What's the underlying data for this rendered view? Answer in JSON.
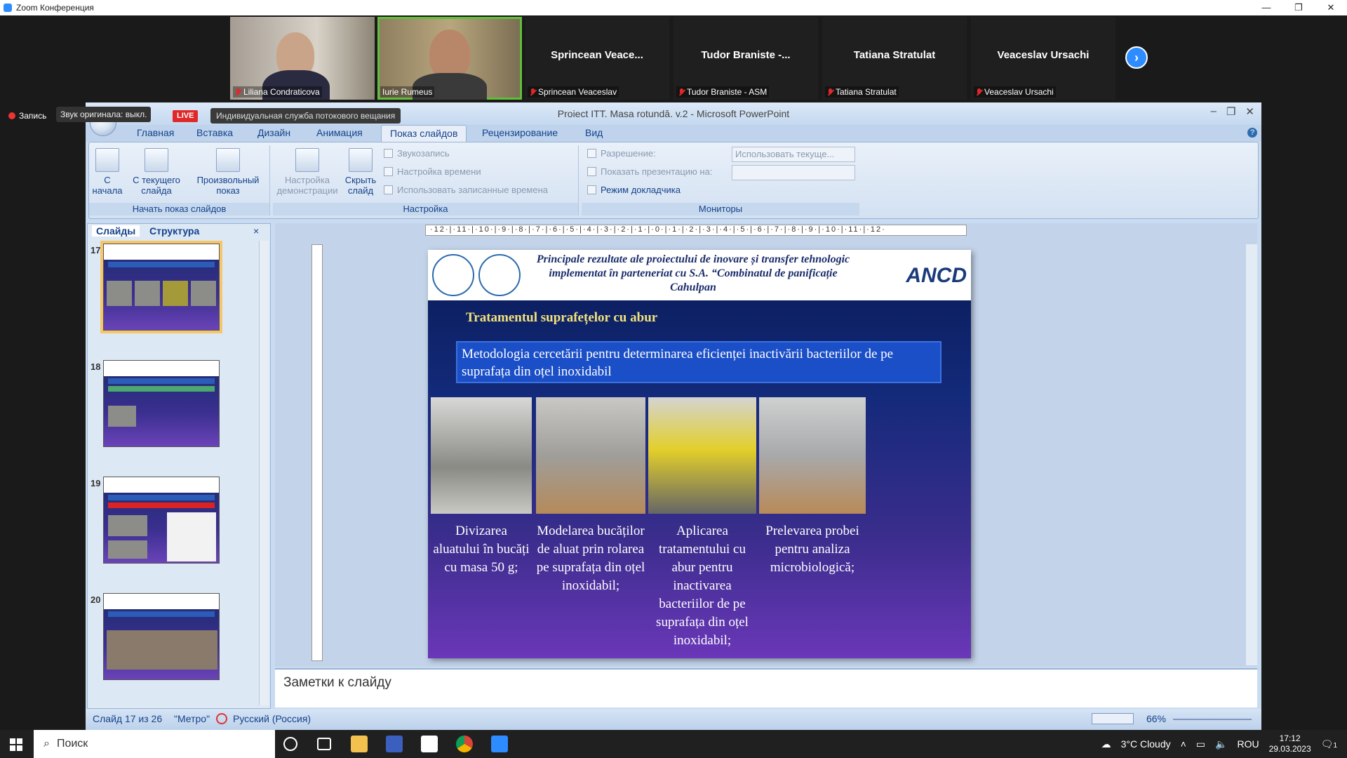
{
  "zoom": {
    "title": "Zoom Конференция"
  },
  "gallery": [
    {
      "label": "Liliana Condraticova",
      "name": ""
    },
    {
      "label": "Iurie Rumeus",
      "name": ""
    },
    {
      "label": "Sprincean Veaceslav",
      "name": "Sprincean  Veace..."
    },
    {
      "label": "Tudor Braniste - ASM",
      "name": "Tudor  Braniste -..."
    },
    {
      "label": "Tatiana Stratulat",
      "name": "Tatiana Stratulat"
    },
    {
      "label": "Veaceslav Ursachi",
      "name": "Veaceslav Ursachi"
    }
  ],
  "zoom_status": {
    "record": "Запись",
    "orig_sound": "Звук оригинала: выкл.",
    "live": "LIVE",
    "stream": "Индивидуальная служба потокового вещания"
  },
  "ppt": {
    "window_title": "Proiect ITT. Masa rotundă. v.2 - Microsoft PowerPoint",
    "tabs": [
      "Главная",
      "Вставка",
      "Дизайн",
      "Анимация",
      "Показ слайдов",
      "Рецензирование",
      "Вид"
    ],
    "ribbon": {
      "start_group": "Начать показ слайдов",
      "from_start": "С начала",
      "from_current": "С текущего слайда",
      "custom": "Произвольный показ",
      "setup_group": "Настройка",
      "setup_demo": "Настройка демонстрации",
      "hide_slide": "Скрыть слайд",
      "record_sound": "Звукозапись",
      "rehearse": "Настройка времени",
      "use_timings": "Использовать записанные времена",
      "monitors_group": "Мониторы",
      "resolution": "Разрешение:",
      "resolution_val": "Использовать текуще...",
      "show_on": "Показать презентацию на:",
      "presenter_view": "Режим докладчика"
    },
    "pane": {
      "tab_slides": "Слайды",
      "tab_outline": "Структура",
      "close": "×",
      "slides": [
        "17",
        "18",
        "19",
        "20"
      ]
    },
    "ruler": "·12·|·11·|·10·|·9·|·8·|·7·|·6·|·5·|·4·|·3·|·2·|·1·|·0·|·1·|·2·|·3·|·4·|·5·|·6·|·7·|·8·|·9·|·10·|·11·|·12·",
    "slide": {
      "header": "Principale rezultate ale proiectului de inovare și transfer tehnologic implementat în parteneriat cu S.A. “Combinatul de panificație Cahulpan",
      "logo": "ANCD",
      "title": "Tratamentul suprafețelor cu abur",
      "box": "Metodologia cercetării pentru determinarea eficienței inactivării bacteriilor de pe suprafața din oțel inoxidabil",
      "captions": [
        "Divizarea aluatului în bucăți cu masa 50 g;",
        "Modelarea bucăților de aluat prin rolarea pe suprafața din oțel inoxidabil;",
        "Aplicarea tratamentului cu abur pentru inactivarea bacteriilor de pe suprafața din oțel inoxidabil;",
        "Prelevarea probei pentru analiza microbiologică;"
      ]
    },
    "notes": "Заметки к слайду",
    "status": {
      "slide": "Слайд 17 из 26",
      "theme": "\"Метро\"",
      "lang": "Русский (Россия)",
      "zoom": "66%"
    }
  },
  "taskbar": {
    "search": "Поиск",
    "weather": "3°C  Cloudy",
    "lang": "ROU",
    "time": "17:12",
    "date": "29.03.2023",
    "notif": "1"
  }
}
